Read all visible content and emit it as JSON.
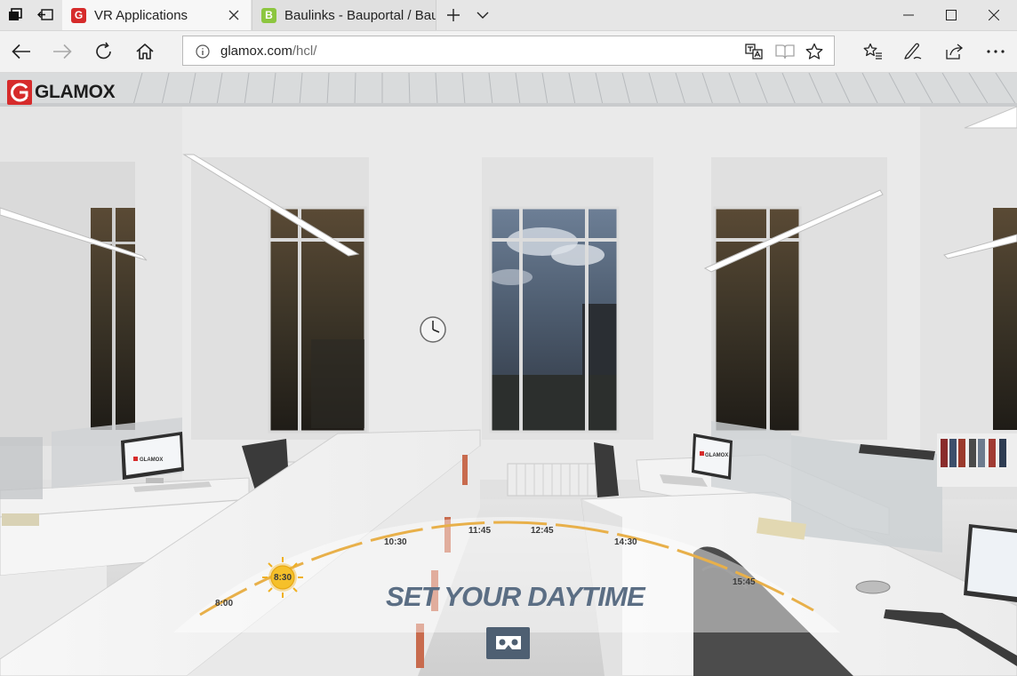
{
  "browser": {
    "tabs": [
      {
        "title": "VR Applications",
        "favicon_letter": "G",
        "favicon_color": "#d62b2b",
        "active": true
      },
      {
        "title": "Baulinks - Bauportal / Baum",
        "favicon_letter": "B",
        "favicon_color": "#8cc63f",
        "active": false
      }
    ],
    "url": {
      "domain": "glamox.com",
      "path": "/hcl/"
    }
  },
  "brand": {
    "name": "GLAMOX",
    "color": "#d62b2b"
  },
  "daytime": {
    "title": "SET YOUR DAYTIME",
    "times": [
      "8:00",
      "8:30",
      "10:30",
      "11:45",
      "12:45",
      "14:30",
      "15:45"
    ],
    "selected": "8:30",
    "arc_color": "#e8b04a",
    "vr_button_color": "#4e5f72"
  },
  "monitor_brand": "GLAMOX"
}
